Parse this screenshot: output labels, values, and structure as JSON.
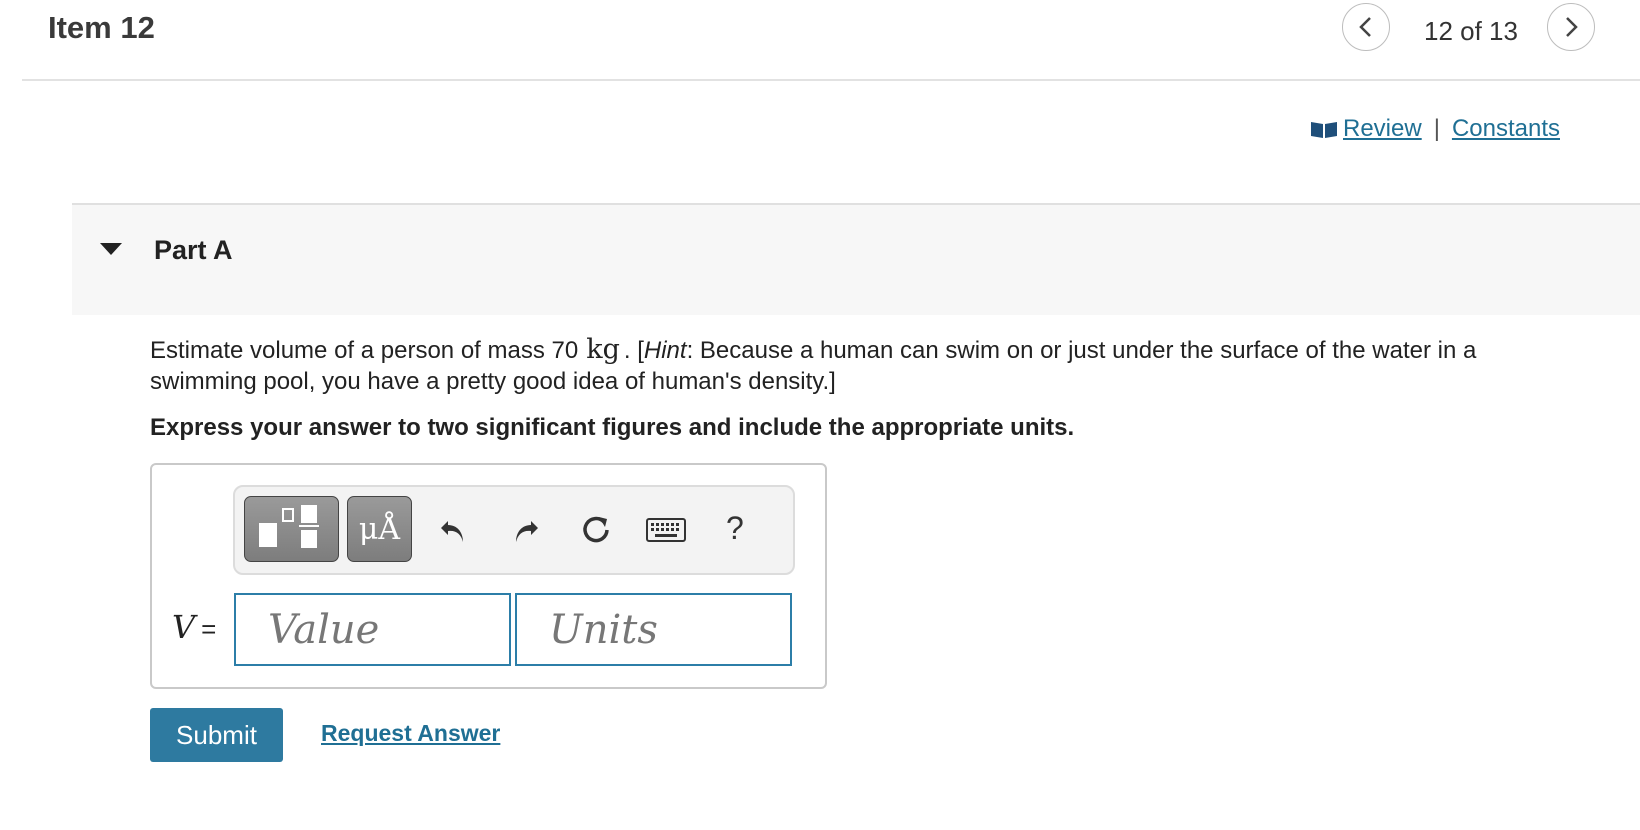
{
  "header": {
    "item_title": "Item 12",
    "counter": "12 of 13",
    "prev_icon": "chevron-left-icon",
    "next_icon": "chevron-right-icon"
  },
  "resources": {
    "review_label": "Review",
    "separator": "|",
    "constants_label": "Constants"
  },
  "part": {
    "title": "Part A"
  },
  "question": {
    "text_before": "Estimate volume of a person of mass 70",
    "unit": "kg",
    "text_after_unit": ". [",
    "hint_label": "Hint",
    "hint_text": ": Because a human can swim on or just under the surface of the water in a swimming pool, you have a pretty good idea of human's density.]",
    "instruction": "Express your answer to two significant figures and include the appropriate units."
  },
  "answer": {
    "variable": "V",
    "equals": "=",
    "value_placeholder": "Value",
    "units_placeholder": "Units",
    "toolbar": {
      "units_symbol": "μÅ",
      "help_label": "?",
      "icons": [
        "templates-icon",
        "units-icon",
        "undo-icon",
        "redo-icon",
        "reset-icon",
        "keyboard-icon",
        "help-icon"
      ]
    }
  },
  "actions": {
    "submit_label": "Submit",
    "request_label": "Request Answer"
  },
  "colors": {
    "accent": "#2e7aa0",
    "link": "#1f6f94",
    "field_border": "#2c7ea8"
  }
}
